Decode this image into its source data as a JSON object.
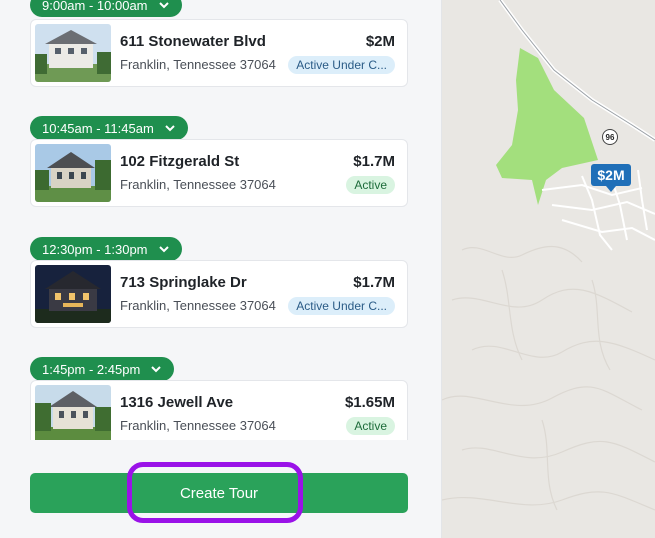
{
  "stops": [
    {
      "time": "9:00am - 10:00am",
      "address": "611 Stonewater Blvd",
      "city": "Franklin, Tennessee 37064",
      "price": "$2M",
      "status": "Active Under C...",
      "status_type": "blue"
    },
    {
      "time": "10:45am - 11:45am",
      "address": "102 Fitzgerald St",
      "city": "Franklin, Tennessee 37064",
      "price": "$1.7M",
      "status": "Active",
      "status_type": "green"
    },
    {
      "time": "12:30pm - 1:30pm",
      "address": "713 Springlake Dr",
      "city": "Franklin, Tennessee 37064",
      "price": "$1.7M",
      "status": "Active Under C...",
      "status_type": "blue"
    },
    {
      "time": "1:45pm - 2:45pm",
      "address": "1316 Jewell Ave",
      "city": "Franklin, Tennessee 37064",
      "price": "$1.65M",
      "status": "Active",
      "status_type": "green"
    }
  ],
  "cta": {
    "label": "Create Tour"
  },
  "map": {
    "marker_label": "$2M",
    "route_shield": "96"
  },
  "colors": {
    "pill": "#1f8f4e",
    "cta": "#2aa25a",
    "highlight": "#9a12e8",
    "marker": "#1f6fb8",
    "park": "#9fe07a"
  }
}
